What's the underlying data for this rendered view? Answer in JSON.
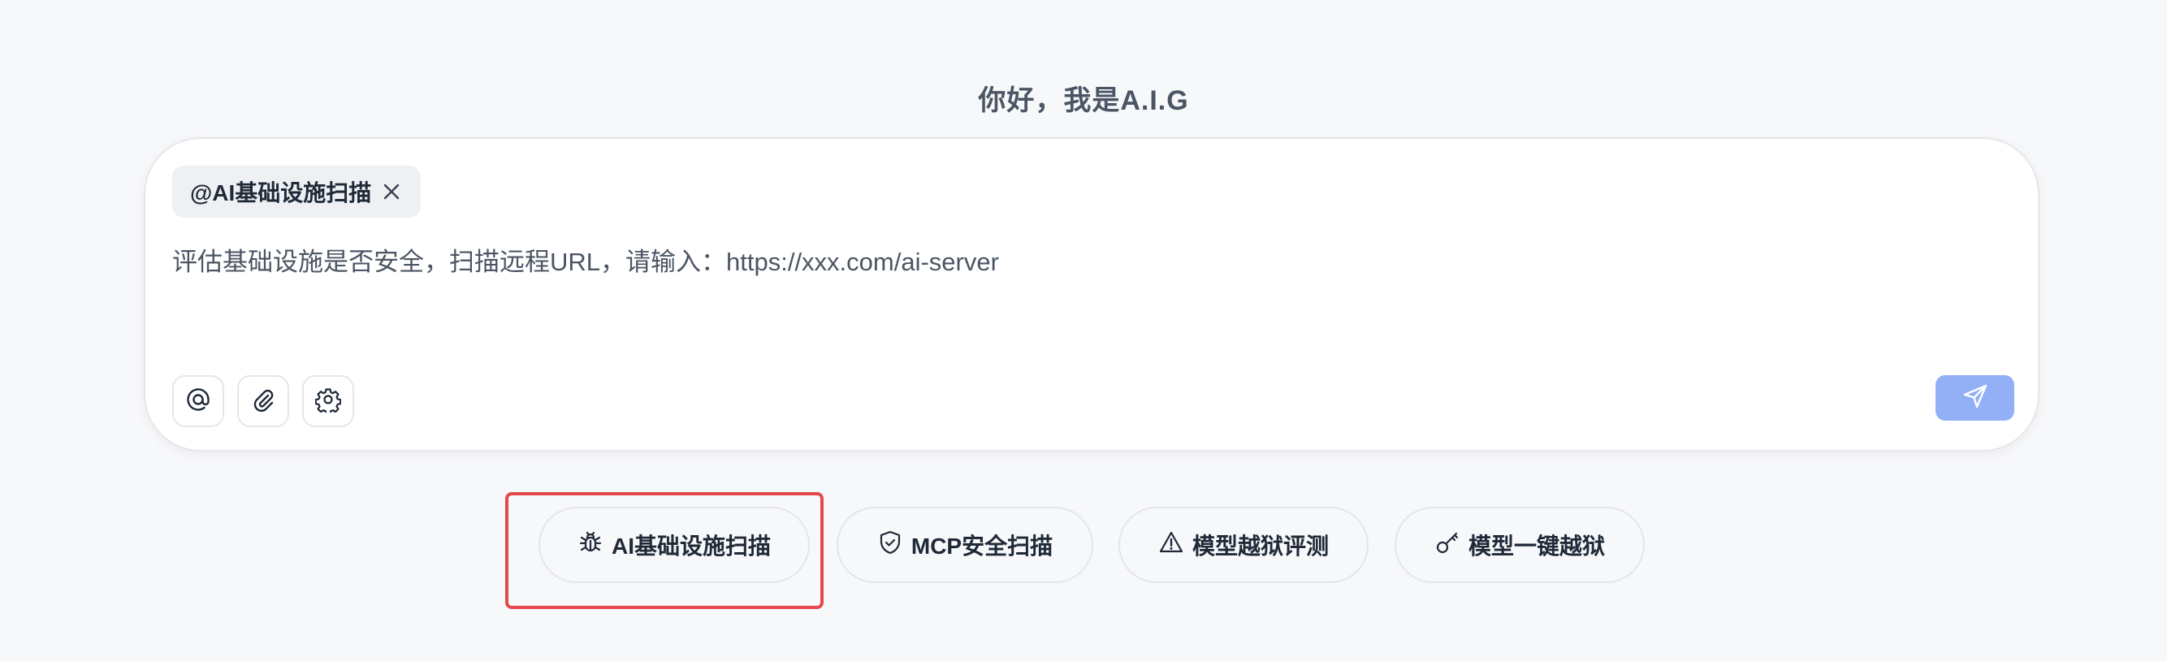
{
  "greeting": "你好，我是A.I.G",
  "chat": {
    "tag_label": "@AI基础设施扫描",
    "prompt_text": "评估基础设施是否安全，扫描远程URL，请输入：https://xxx.com/ai-server"
  },
  "toolbar": {
    "icons": [
      "at-icon",
      "paperclip-icon",
      "gear-icon"
    ],
    "send_icon": "send-icon",
    "send_color": "#93b0f7"
  },
  "quick_actions": [
    {
      "label": "AI基础设施扫描",
      "icon": "bug-icon",
      "highlighted": true
    },
    {
      "label": "MCP安全扫描",
      "icon": "shield-check-icon"
    },
    {
      "label": "模型越狱评测",
      "icon": "warning-icon"
    },
    {
      "label": "模型一键越狱",
      "icon": "key-icon"
    }
  ],
  "colors": {
    "highlight": "#e5484d",
    "background": "#f7f8fa"
  }
}
